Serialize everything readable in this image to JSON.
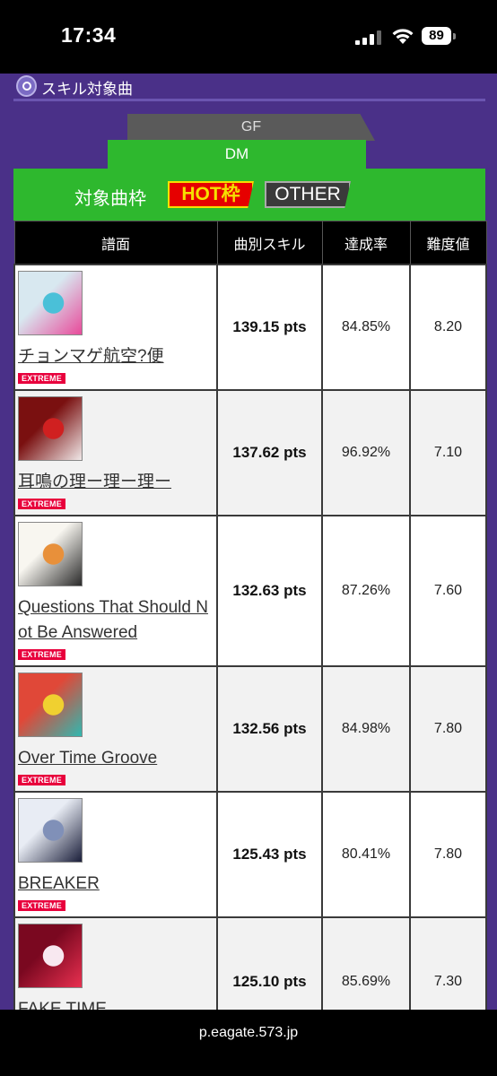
{
  "status_bar": {
    "time": "17:34",
    "battery": "89"
  },
  "section": {
    "title": "スキル対象曲"
  },
  "tabs": {
    "gf": "GF",
    "dm": "DM"
  },
  "frame": {
    "label": "対象曲枠",
    "hot": "HOT枠",
    "other": "OTHER"
  },
  "table": {
    "headers": [
      "譜面",
      "曲別スキル",
      "達成率",
      "難度値"
    ],
    "rows": [
      {
        "title": "チョンマゲ航空?便",
        "difficulty": "EXTREME",
        "skill": "139.15 pts",
        "rate": "84.85%",
        "level": "8.20",
        "jacket_colors": [
          "#d8e8f0",
          "#e84a9a",
          "#4ac0d8"
        ]
      },
      {
        "title": "耳鳴の理ー理ー理ー",
        "difficulty": "EXTREME",
        "skill": "137.62 pts",
        "rate": "96.92%",
        "level": "7.10",
        "jacket_colors": [
          "#7a1010",
          "#f0e8e8",
          "#d02020"
        ]
      },
      {
        "title": "Questions That Should Not Be Answered",
        "difficulty": "EXTREME",
        "skill": "132.63 pts",
        "rate": "87.26%",
        "level": "7.60",
        "jacket_colors": [
          "#f8f6f0",
          "#2a2a2a",
          "#e8903a"
        ]
      },
      {
        "title": "Over Time Groove",
        "difficulty": "EXTREME",
        "skill": "132.56 pts",
        "rate": "84.98%",
        "level": "7.80",
        "jacket_colors": [
          "#e04838",
          "#30b8b0",
          "#f0d030"
        ]
      },
      {
        "title": "BREAKER",
        "difficulty": "EXTREME",
        "skill": "125.43 pts",
        "rate": "80.41%",
        "level": "7.80",
        "jacket_colors": [
          "#e8ecf4",
          "#1a1e3a",
          "#8090b8"
        ]
      },
      {
        "title": "FAKE TIME",
        "difficulty": "",
        "skill": "125.10 pts",
        "rate": "85.69%",
        "level": "7.30",
        "jacket_colors": [
          "#7a0820",
          "#e83050",
          "#f8e8f0"
        ]
      }
    ]
  },
  "url": "p.eagate.573.jp"
}
